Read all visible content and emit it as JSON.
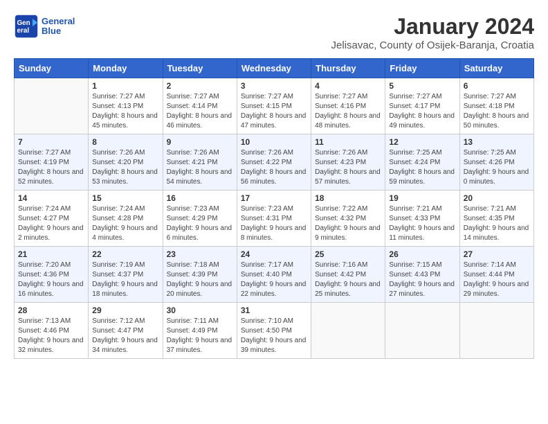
{
  "header": {
    "logo_line1": "General",
    "logo_line2": "Blue",
    "month": "January 2024",
    "location": "Jelisavac, County of Osijek-Baranja, Croatia"
  },
  "days_of_week": [
    "Sunday",
    "Monday",
    "Tuesday",
    "Wednesday",
    "Thursday",
    "Friday",
    "Saturday"
  ],
  "weeks": [
    [
      {
        "day": "",
        "sunrise": "",
        "sunset": "",
        "daylight": ""
      },
      {
        "day": "1",
        "sunrise": "Sunrise: 7:27 AM",
        "sunset": "Sunset: 4:13 PM",
        "daylight": "Daylight: 8 hours and 45 minutes."
      },
      {
        "day": "2",
        "sunrise": "Sunrise: 7:27 AM",
        "sunset": "Sunset: 4:14 PM",
        "daylight": "Daylight: 8 hours and 46 minutes."
      },
      {
        "day": "3",
        "sunrise": "Sunrise: 7:27 AM",
        "sunset": "Sunset: 4:15 PM",
        "daylight": "Daylight: 8 hours and 47 minutes."
      },
      {
        "day": "4",
        "sunrise": "Sunrise: 7:27 AM",
        "sunset": "Sunset: 4:16 PM",
        "daylight": "Daylight: 8 hours and 48 minutes."
      },
      {
        "day": "5",
        "sunrise": "Sunrise: 7:27 AM",
        "sunset": "Sunset: 4:17 PM",
        "daylight": "Daylight: 8 hours and 49 minutes."
      },
      {
        "day": "6",
        "sunrise": "Sunrise: 7:27 AM",
        "sunset": "Sunset: 4:18 PM",
        "daylight": "Daylight: 8 hours and 50 minutes."
      }
    ],
    [
      {
        "day": "7",
        "sunrise": "Sunrise: 7:27 AM",
        "sunset": "Sunset: 4:19 PM",
        "daylight": "Daylight: 8 hours and 52 minutes."
      },
      {
        "day": "8",
        "sunrise": "Sunrise: 7:26 AM",
        "sunset": "Sunset: 4:20 PM",
        "daylight": "Daylight: 8 hours and 53 minutes."
      },
      {
        "day": "9",
        "sunrise": "Sunrise: 7:26 AM",
        "sunset": "Sunset: 4:21 PM",
        "daylight": "Daylight: 8 hours and 54 minutes."
      },
      {
        "day": "10",
        "sunrise": "Sunrise: 7:26 AM",
        "sunset": "Sunset: 4:22 PM",
        "daylight": "Daylight: 8 hours and 56 minutes."
      },
      {
        "day": "11",
        "sunrise": "Sunrise: 7:26 AM",
        "sunset": "Sunset: 4:23 PM",
        "daylight": "Daylight: 8 hours and 57 minutes."
      },
      {
        "day": "12",
        "sunrise": "Sunrise: 7:25 AM",
        "sunset": "Sunset: 4:24 PM",
        "daylight": "Daylight: 8 hours and 59 minutes."
      },
      {
        "day": "13",
        "sunrise": "Sunrise: 7:25 AM",
        "sunset": "Sunset: 4:26 PM",
        "daylight": "Daylight: 9 hours and 0 minutes."
      }
    ],
    [
      {
        "day": "14",
        "sunrise": "Sunrise: 7:24 AM",
        "sunset": "Sunset: 4:27 PM",
        "daylight": "Daylight: 9 hours and 2 minutes."
      },
      {
        "day": "15",
        "sunrise": "Sunrise: 7:24 AM",
        "sunset": "Sunset: 4:28 PM",
        "daylight": "Daylight: 9 hours and 4 minutes."
      },
      {
        "day": "16",
        "sunrise": "Sunrise: 7:23 AM",
        "sunset": "Sunset: 4:29 PM",
        "daylight": "Daylight: 9 hours and 6 minutes."
      },
      {
        "day": "17",
        "sunrise": "Sunrise: 7:23 AM",
        "sunset": "Sunset: 4:31 PM",
        "daylight": "Daylight: 9 hours and 8 minutes."
      },
      {
        "day": "18",
        "sunrise": "Sunrise: 7:22 AM",
        "sunset": "Sunset: 4:32 PM",
        "daylight": "Daylight: 9 hours and 9 minutes."
      },
      {
        "day": "19",
        "sunrise": "Sunrise: 7:21 AM",
        "sunset": "Sunset: 4:33 PM",
        "daylight": "Daylight: 9 hours and 11 minutes."
      },
      {
        "day": "20",
        "sunrise": "Sunrise: 7:21 AM",
        "sunset": "Sunset: 4:35 PM",
        "daylight": "Daylight: 9 hours and 14 minutes."
      }
    ],
    [
      {
        "day": "21",
        "sunrise": "Sunrise: 7:20 AM",
        "sunset": "Sunset: 4:36 PM",
        "daylight": "Daylight: 9 hours and 16 minutes."
      },
      {
        "day": "22",
        "sunrise": "Sunrise: 7:19 AM",
        "sunset": "Sunset: 4:37 PM",
        "daylight": "Daylight: 9 hours and 18 minutes."
      },
      {
        "day": "23",
        "sunrise": "Sunrise: 7:18 AM",
        "sunset": "Sunset: 4:39 PM",
        "daylight": "Daylight: 9 hours and 20 minutes."
      },
      {
        "day": "24",
        "sunrise": "Sunrise: 7:17 AM",
        "sunset": "Sunset: 4:40 PM",
        "daylight": "Daylight: 9 hours and 22 minutes."
      },
      {
        "day": "25",
        "sunrise": "Sunrise: 7:16 AM",
        "sunset": "Sunset: 4:42 PM",
        "daylight": "Daylight: 9 hours and 25 minutes."
      },
      {
        "day": "26",
        "sunrise": "Sunrise: 7:15 AM",
        "sunset": "Sunset: 4:43 PM",
        "daylight": "Daylight: 9 hours and 27 minutes."
      },
      {
        "day": "27",
        "sunrise": "Sunrise: 7:14 AM",
        "sunset": "Sunset: 4:44 PM",
        "daylight": "Daylight: 9 hours and 29 minutes."
      }
    ],
    [
      {
        "day": "28",
        "sunrise": "Sunrise: 7:13 AM",
        "sunset": "Sunset: 4:46 PM",
        "daylight": "Daylight: 9 hours and 32 minutes."
      },
      {
        "day": "29",
        "sunrise": "Sunrise: 7:12 AM",
        "sunset": "Sunset: 4:47 PM",
        "daylight": "Daylight: 9 hours and 34 minutes."
      },
      {
        "day": "30",
        "sunrise": "Sunrise: 7:11 AM",
        "sunset": "Sunset: 4:49 PM",
        "daylight": "Daylight: 9 hours and 37 minutes."
      },
      {
        "day": "31",
        "sunrise": "Sunrise: 7:10 AM",
        "sunset": "Sunset: 4:50 PM",
        "daylight": "Daylight: 9 hours and 39 minutes."
      },
      {
        "day": "",
        "sunrise": "",
        "sunset": "",
        "daylight": ""
      },
      {
        "day": "",
        "sunrise": "",
        "sunset": "",
        "daylight": ""
      },
      {
        "day": "",
        "sunrise": "",
        "sunset": "",
        "daylight": ""
      }
    ]
  ]
}
